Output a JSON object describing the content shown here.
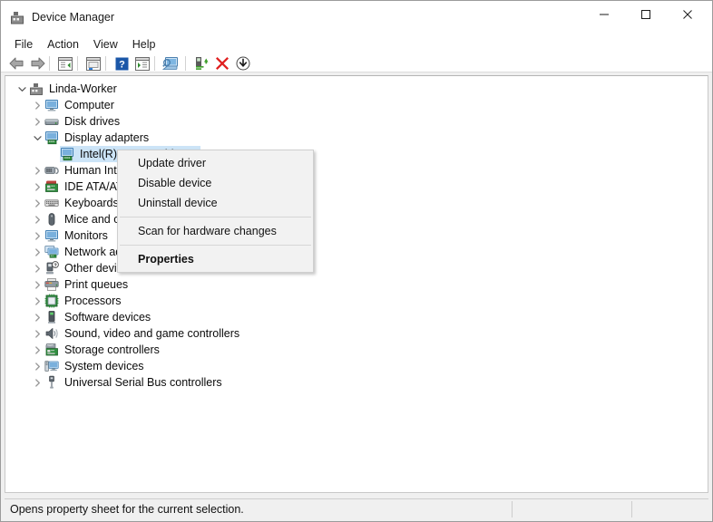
{
  "window": {
    "title": "Device Manager",
    "title_icon": "device-manager-icon",
    "minimize_label": "—",
    "maximize_label": "□",
    "close_label": "×"
  },
  "menubar": {
    "items": [
      {
        "label": "File"
      },
      {
        "label": "Action"
      },
      {
        "label": "View"
      },
      {
        "label": "Help"
      }
    ]
  },
  "toolbar": {
    "items": [
      {
        "name": "back-icon",
        "tip": "Back"
      },
      {
        "name": "forward-icon",
        "tip": "Forward"
      },
      {
        "name": "show-hide-console-tree-icon",
        "tip": "Show/Hide Console Tree"
      },
      {
        "name": "properties-icon",
        "tip": "Properties"
      },
      {
        "name": "help-icon",
        "tip": "Help"
      },
      {
        "name": "update-driver-icon",
        "tip": "Update driver"
      },
      {
        "name": "scan-hardware-changes-icon",
        "tip": "Scan for hardware changes"
      },
      {
        "name": "enable-device-icon",
        "tip": "Enable device"
      },
      {
        "name": "uninstall-device-icon",
        "tip": "Uninstall device"
      },
      {
        "name": "disable-device-icon",
        "tip": "Disable device"
      }
    ]
  },
  "tree": {
    "root": {
      "label": "Linda-Worker",
      "icon": "computer-root-icon",
      "expanded": true
    },
    "items": [
      {
        "label": "Computer",
        "icon": "computer-icon",
        "expanded": false,
        "selected": false
      },
      {
        "label": "Disk drives",
        "icon": "disk-drive-icon",
        "expanded": false,
        "selected": false
      },
      {
        "label": "Display adapters",
        "icon": "display-adapter-icon",
        "expanded": true,
        "selected": false
      },
      {
        "label": "Intel(R) HD Graphics",
        "icon": "display-adapter-icon",
        "expanded": null,
        "selected": true,
        "child": true
      },
      {
        "label": "Human Interface Devices",
        "icon": "hid-icon",
        "expanded": false,
        "selected": false
      },
      {
        "label": "IDE ATA/ATAPI controllers",
        "icon": "ide-controller-icon",
        "expanded": false,
        "selected": false
      },
      {
        "label": "Keyboards",
        "icon": "keyboard-icon",
        "expanded": false,
        "selected": false
      },
      {
        "label": "Mice and other pointing devices",
        "icon": "mouse-icon",
        "expanded": false,
        "selected": false
      },
      {
        "label": "Monitors",
        "icon": "monitor-icon",
        "expanded": false,
        "selected": false
      },
      {
        "label": "Network adapters",
        "icon": "network-adapter-icon",
        "expanded": false,
        "selected": false
      },
      {
        "label": "Other devices",
        "icon": "other-device-icon",
        "expanded": false,
        "selected": false
      },
      {
        "label": "Print queues",
        "icon": "printer-icon",
        "expanded": false,
        "selected": false
      },
      {
        "label": "Processors",
        "icon": "processor-icon",
        "expanded": false,
        "selected": false
      },
      {
        "label": "Software devices",
        "icon": "software-device-icon",
        "expanded": false,
        "selected": false
      },
      {
        "label": "Sound, video and game controllers",
        "icon": "sound-icon",
        "expanded": false,
        "selected": false
      },
      {
        "label": "Storage controllers",
        "icon": "storage-controller-icon",
        "expanded": false,
        "selected": false
      },
      {
        "label": "System devices",
        "icon": "system-device-icon",
        "expanded": false,
        "selected": false
      },
      {
        "label": "Universal Serial Bus controllers",
        "icon": "usb-icon",
        "expanded": false,
        "selected": false
      }
    ]
  },
  "context_menu": {
    "visible": true,
    "items": [
      {
        "label": "Update driver",
        "type": "item",
        "bold": false
      },
      {
        "label": "Disable device",
        "type": "item",
        "bold": false
      },
      {
        "label": "Uninstall device",
        "type": "item",
        "bold": false
      },
      {
        "label": "",
        "type": "separator"
      },
      {
        "label": "Scan for hardware changes",
        "type": "item",
        "bold": false
      },
      {
        "label": "",
        "type": "separator"
      },
      {
        "label": "Properties",
        "type": "item",
        "bold": true
      }
    ]
  },
  "statusbar": {
    "message": "Opens property sheet for the current selection.",
    "panel2": "",
    "panel3": ""
  },
  "colors": {
    "selection": "#cce4f7",
    "menu_bg": "#f2f2f2",
    "window_bg": "#ffffff",
    "status_bg": "#f0f0f0",
    "close_red": "#e81123",
    "accent_green": "#3d9e2a"
  }
}
